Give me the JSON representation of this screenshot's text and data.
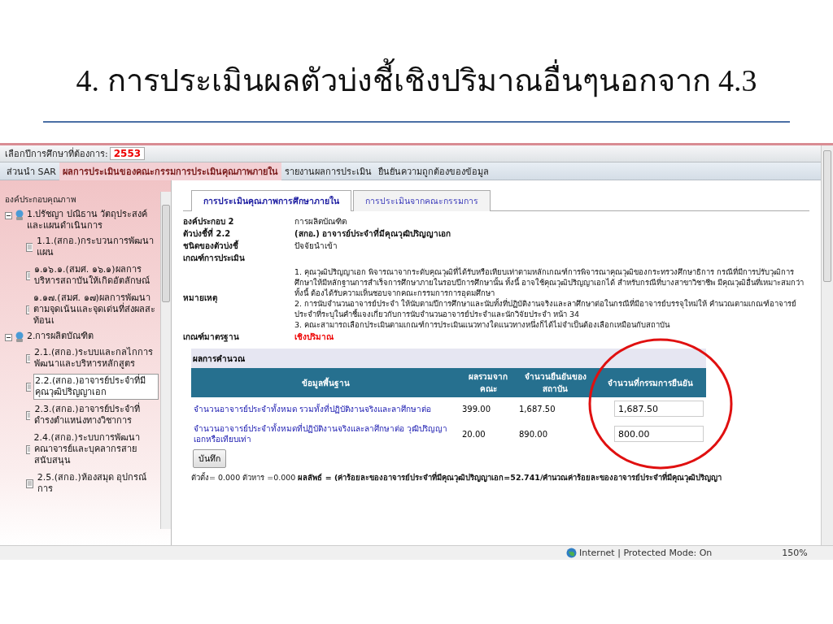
{
  "slide_title": "4. การประเมินผลตัวบ่งชี้เชิงปริมาณอื่นๆนอกจาก 4.3",
  "year_bar": {
    "label": "เลือกปีการศึกษาที่ต้องการ:",
    "value": "2553"
  },
  "menu": [
    {
      "label": "ส่วนนำ SAR",
      "selected": false
    },
    {
      "label": "ผลการประเมินของคณะกรรมการประเมินคุณภาพภายใน",
      "selected": true
    },
    {
      "label": "รายงานผลการประเมิน",
      "selected": false
    },
    {
      "label": "ยืนยันความถูกต้องของข้อมูล",
      "selected": false
    }
  ],
  "sidebar": {
    "heading": "องค์ประกอบคุณภาพ",
    "tree": [
      {
        "label": "1.ปรัชญา ปณิธาน วัตถุประสงค์ และแผนดำเนินการ",
        "expanded": true,
        "children": [
          {
            "label": "1.1.(สกอ.)กระบวนการพัฒนาแผน",
            "selected": false
          },
          {
            "label": "๑.๑๖.๑.(สมศ. ๑๖.๑)ผลการบริหารสถาบันให้เกิดอัตลักษณ์",
            "selected": false
          },
          {
            "label": "๑.๑๗.(สมศ. ๑๗)ผลการพัฒนาตามจุดเน้นและจุดเด่นที่ส่งผลสะท้อนเ",
            "selected": false
          }
        ]
      },
      {
        "label": "2.การผลิตบัณฑิต",
        "expanded": true,
        "children": [
          {
            "label": "2.1.(สกอ.)ระบบและกลไกการพัฒนาและบริหารหลักสูตร",
            "selected": false
          },
          {
            "label": "2.2.(สกอ.)อาจารย์ประจำที่มีคุณวุฒิปริญญาเอก",
            "selected": true
          },
          {
            "label": "2.3.(สกอ.)อาจารย์ประจำที่ดำรงตำแหน่งทางวิชาการ",
            "selected": false
          },
          {
            "label": "2.4.(สกอ.)ระบบการพัฒนาคณาจารย์และบุคลากรสายสนับสนุน",
            "selected": false
          },
          {
            "label": "2.5.(สกอ.)ห้องสมุด อุปกรณ์การ",
            "selected": false
          }
        ]
      }
    ]
  },
  "content_tabs": [
    {
      "label": "การประเมินคุณภาพการศึกษาภายใน",
      "selected": true
    },
    {
      "label": "การประเมินจากคณะกรรมการ",
      "selected": false
    }
  ],
  "fields": [
    {
      "kind": "plain",
      "label": "องค์ประกอบ 2",
      "value": "การผลิตบัณฑิต"
    },
    {
      "kind": "strong",
      "label": "ตัวบ่งชี้ที่ 2.2",
      "value": "(สกอ.) อาจารย์ประจำที่มีคุณวุฒิปริญญาเอก"
    },
    {
      "kind": "plain",
      "label": "ชนิดของตัวบ่งชี้",
      "value": "ปัจจัยนำเข้า"
    },
    {
      "kind": "heading",
      "label": "เกณฑ์การประเมิน"
    },
    {
      "kind": "notes",
      "label": "หมายเหตุ",
      "notes": [
        "1. คุณวุฒิปริญญาเอก พิจารณาจากระดับคุณวุฒิที่ได้รับหรือเทียบเท่าตามหลักเกณฑ์การพิจารณาคุณวุฒิของกระทรวงศึกษาธิการ กรณีที่มีการปรับวุฒิการศึกษาให้มีหลักฐานการสำเร็จการศึกษาภายในรอบปีการศึกษานั้น ทั้งนี้ อาจใช้คุณวุฒิปริญญาเอกได้ สำหรับกรณีที่บางสาขาวิชาชีพ มีคุณวุฒิอื่นที่เหมาะสมกว่า ทั้งนี้ ต้องได้รับความเห็นชอบจากคณะกรรมการการอุดมศึกษา",
        "2. การนับจำนวนอาจารย์ประจำ ให้นับตามปีการศึกษาและนับทั้งที่ปฏิบัติงานจริงและลาศึกษาต่อในกรณีที่มีอาจารย์บรรจุใหม่ให้ คำนวณตามเกณฑ์อาจารย์ประจำที่ระบุในคำชี้แจงเกี่ยวกับการนับจำนวนอาจารย์ประจำและนักวิจัยประจำ หน้า 34",
        "3. คณะสามารถเลือกประเมินตามเกณฑ์การประเมินแนวทางใดแนวทางหนึ่งก็ได้ไม่จำเป็นต้องเลือกเหมือนกับสถาบัน"
      ]
    },
    {
      "kind": "alert",
      "label": "เกณฑ์มาตรฐาน",
      "value": "เชิงปริมาณ"
    }
  ],
  "calc": {
    "title": "ผลการคำนวณ",
    "columns": [
      "ข้อมูลพื้นฐาน",
      "ผลรวมจากคณะ",
      "จำนวนยืนยันของสถาบัน",
      "จำนวนที่กรรมการยืนยัน"
    ],
    "rows": [
      {
        "item": "จำนวนอาจารย์ประจำทั้งหมด รวมทั้งที่ปฏิบัติงานจริงและลาศึกษาต่อ",
        "faculty_total": "399.00",
        "institution": "1,687.50",
        "committee": "1,687.50"
      },
      {
        "item": "จำนวนอาจารย์ประจำทั้งหมดที่ปฏิบัติงานจริงและลาศึกษาต่อ วุฒิปริญญาเอกหรือเทียบเท่า",
        "faculty_total": "20.00",
        "institution": "890.00",
        "committee": "800.00"
      }
    ],
    "save_button": "บันทึก",
    "formula": "ตัวตั้ง= 0.000  ตัวหาร =0.000  **ผลลัพธ์ = (ค่าร้อยละของอาจารย์ประจำที่มีคุณวุฒิปริญญาเอก=52.741/คำนวณค่าร้อยละของอาจารย์ประจำที่มีคุณวุฒิปริญญา**"
  },
  "status_bar": {
    "zone": "Internet | Protected Mode: On",
    "zoom": "150%"
  }
}
